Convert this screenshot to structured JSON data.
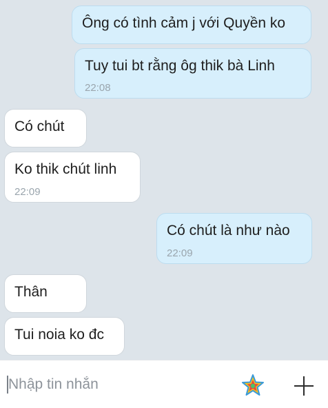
{
  "messages": [
    {
      "direction": "out",
      "text": "Ông có tình cảm j với Quyền ko",
      "time": ""
    },
    {
      "direction": "out",
      "text": "Tuy tui bt rằng ôg thik bà Linh",
      "time": "22:08"
    },
    {
      "direction": "in",
      "text": "Có chút",
      "time": ""
    },
    {
      "direction": "in",
      "text": "Ko thik chút linh",
      "time": "22:09"
    },
    {
      "direction": "out",
      "text": "Có chút là như nào",
      "time": "22:09"
    },
    {
      "direction": "in",
      "text": "Thân",
      "time": ""
    },
    {
      "direction": "in",
      "text": "Tui noia ko đc",
      "time": ""
    }
  ],
  "composer": {
    "placeholder": "Nhập tin nhắn",
    "value": "",
    "sticker_icon": "sticker-star-icon",
    "add_icon": "plus-icon"
  },
  "colors": {
    "background": "#dde4ea",
    "outgoing_bubble": "#d7effc",
    "incoming_bubble": "#ffffff",
    "timestamp": "#9aa5ad"
  }
}
